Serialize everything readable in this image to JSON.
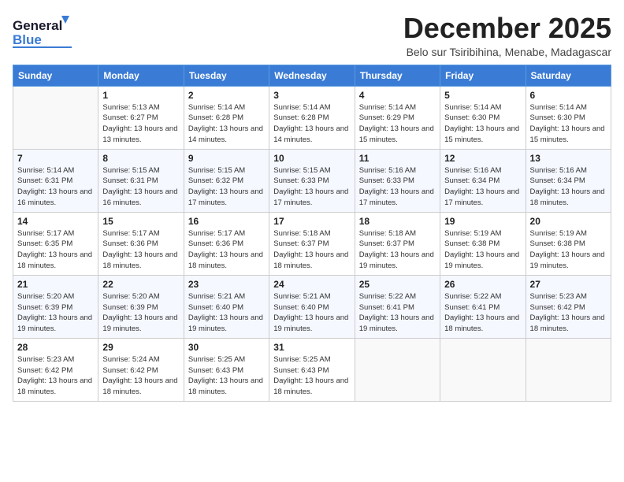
{
  "logo": {
    "line1": "General",
    "line2": "Blue"
  },
  "header": {
    "month": "December 2025",
    "location": "Belo sur Tsiribihina, Menabe, Madagascar"
  },
  "weekdays": [
    "Sunday",
    "Monday",
    "Tuesday",
    "Wednesday",
    "Thursday",
    "Friday",
    "Saturday"
  ],
  "weeks": [
    [
      {
        "day": "",
        "sunrise": "",
        "sunset": "",
        "daylight": ""
      },
      {
        "day": "1",
        "sunrise": "Sunrise: 5:13 AM",
        "sunset": "Sunset: 6:27 PM",
        "daylight": "Daylight: 13 hours and 13 minutes."
      },
      {
        "day": "2",
        "sunrise": "Sunrise: 5:14 AM",
        "sunset": "Sunset: 6:28 PM",
        "daylight": "Daylight: 13 hours and 14 minutes."
      },
      {
        "day": "3",
        "sunrise": "Sunrise: 5:14 AM",
        "sunset": "Sunset: 6:28 PM",
        "daylight": "Daylight: 13 hours and 14 minutes."
      },
      {
        "day": "4",
        "sunrise": "Sunrise: 5:14 AM",
        "sunset": "Sunset: 6:29 PM",
        "daylight": "Daylight: 13 hours and 15 minutes."
      },
      {
        "day": "5",
        "sunrise": "Sunrise: 5:14 AM",
        "sunset": "Sunset: 6:30 PM",
        "daylight": "Daylight: 13 hours and 15 minutes."
      },
      {
        "day": "6",
        "sunrise": "Sunrise: 5:14 AM",
        "sunset": "Sunset: 6:30 PM",
        "daylight": "Daylight: 13 hours and 15 minutes."
      }
    ],
    [
      {
        "day": "7",
        "sunrise": "Sunrise: 5:14 AM",
        "sunset": "Sunset: 6:31 PM",
        "daylight": "Daylight: 13 hours and 16 minutes."
      },
      {
        "day": "8",
        "sunrise": "Sunrise: 5:15 AM",
        "sunset": "Sunset: 6:31 PM",
        "daylight": "Daylight: 13 hours and 16 minutes."
      },
      {
        "day": "9",
        "sunrise": "Sunrise: 5:15 AM",
        "sunset": "Sunset: 6:32 PM",
        "daylight": "Daylight: 13 hours and 17 minutes."
      },
      {
        "day": "10",
        "sunrise": "Sunrise: 5:15 AM",
        "sunset": "Sunset: 6:33 PM",
        "daylight": "Daylight: 13 hours and 17 minutes."
      },
      {
        "day": "11",
        "sunrise": "Sunrise: 5:16 AM",
        "sunset": "Sunset: 6:33 PM",
        "daylight": "Daylight: 13 hours and 17 minutes."
      },
      {
        "day": "12",
        "sunrise": "Sunrise: 5:16 AM",
        "sunset": "Sunset: 6:34 PM",
        "daylight": "Daylight: 13 hours and 17 minutes."
      },
      {
        "day": "13",
        "sunrise": "Sunrise: 5:16 AM",
        "sunset": "Sunset: 6:34 PM",
        "daylight": "Daylight: 13 hours and 18 minutes."
      }
    ],
    [
      {
        "day": "14",
        "sunrise": "Sunrise: 5:17 AM",
        "sunset": "Sunset: 6:35 PM",
        "daylight": "Daylight: 13 hours and 18 minutes."
      },
      {
        "day": "15",
        "sunrise": "Sunrise: 5:17 AM",
        "sunset": "Sunset: 6:36 PM",
        "daylight": "Daylight: 13 hours and 18 minutes."
      },
      {
        "day": "16",
        "sunrise": "Sunrise: 5:17 AM",
        "sunset": "Sunset: 6:36 PM",
        "daylight": "Daylight: 13 hours and 18 minutes."
      },
      {
        "day": "17",
        "sunrise": "Sunrise: 5:18 AM",
        "sunset": "Sunset: 6:37 PM",
        "daylight": "Daylight: 13 hours and 18 minutes."
      },
      {
        "day": "18",
        "sunrise": "Sunrise: 5:18 AM",
        "sunset": "Sunset: 6:37 PM",
        "daylight": "Daylight: 13 hours and 19 minutes."
      },
      {
        "day": "19",
        "sunrise": "Sunrise: 5:19 AM",
        "sunset": "Sunset: 6:38 PM",
        "daylight": "Daylight: 13 hours and 19 minutes."
      },
      {
        "day": "20",
        "sunrise": "Sunrise: 5:19 AM",
        "sunset": "Sunset: 6:38 PM",
        "daylight": "Daylight: 13 hours and 19 minutes."
      }
    ],
    [
      {
        "day": "21",
        "sunrise": "Sunrise: 5:20 AM",
        "sunset": "Sunset: 6:39 PM",
        "daylight": "Daylight: 13 hours and 19 minutes."
      },
      {
        "day": "22",
        "sunrise": "Sunrise: 5:20 AM",
        "sunset": "Sunset: 6:39 PM",
        "daylight": "Daylight: 13 hours and 19 minutes."
      },
      {
        "day": "23",
        "sunrise": "Sunrise: 5:21 AM",
        "sunset": "Sunset: 6:40 PM",
        "daylight": "Daylight: 13 hours and 19 minutes."
      },
      {
        "day": "24",
        "sunrise": "Sunrise: 5:21 AM",
        "sunset": "Sunset: 6:40 PM",
        "daylight": "Daylight: 13 hours and 19 minutes."
      },
      {
        "day": "25",
        "sunrise": "Sunrise: 5:22 AM",
        "sunset": "Sunset: 6:41 PM",
        "daylight": "Daylight: 13 hours and 19 minutes."
      },
      {
        "day": "26",
        "sunrise": "Sunrise: 5:22 AM",
        "sunset": "Sunset: 6:41 PM",
        "daylight": "Daylight: 13 hours and 18 minutes."
      },
      {
        "day": "27",
        "sunrise": "Sunrise: 5:23 AM",
        "sunset": "Sunset: 6:42 PM",
        "daylight": "Daylight: 13 hours and 18 minutes."
      }
    ],
    [
      {
        "day": "28",
        "sunrise": "Sunrise: 5:23 AM",
        "sunset": "Sunset: 6:42 PM",
        "daylight": "Daylight: 13 hours and 18 minutes."
      },
      {
        "day": "29",
        "sunrise": "Sunrise: 5:24 AM",
        "sunset": "Sunset: 6:42 PM",
        "daylight": "Daylight: 13 hours and 18 minutes."
      },
      {
        "day": "30",
        "sunrise": "Sunrise: 5:25 AM",
        "sunset": "Sunset: 6:43 PM",
        "daylight": "Daylight: 13 hours and 18 minutes."
      },
      {
        "day": "31",
        "sunrise": "Sunrise: 5:25 AM",
        "sunset": "Sunset: 6:43 PM",
        "daylight": "Daylight: 13 hours and 18 minutes."
      },
      {
        "day": "",
        "sunrise": "",
        "sunset": "",
        "daylight": ""
      },
      {
        "day": "",
        "sunrise": "",
        "sunset": "",
        "daylight": ""
      },
      {
        "day": "",
        "sunrise": "",
        "sunset": "",
        "daylight": ""
      }
    ]
  ]
}
